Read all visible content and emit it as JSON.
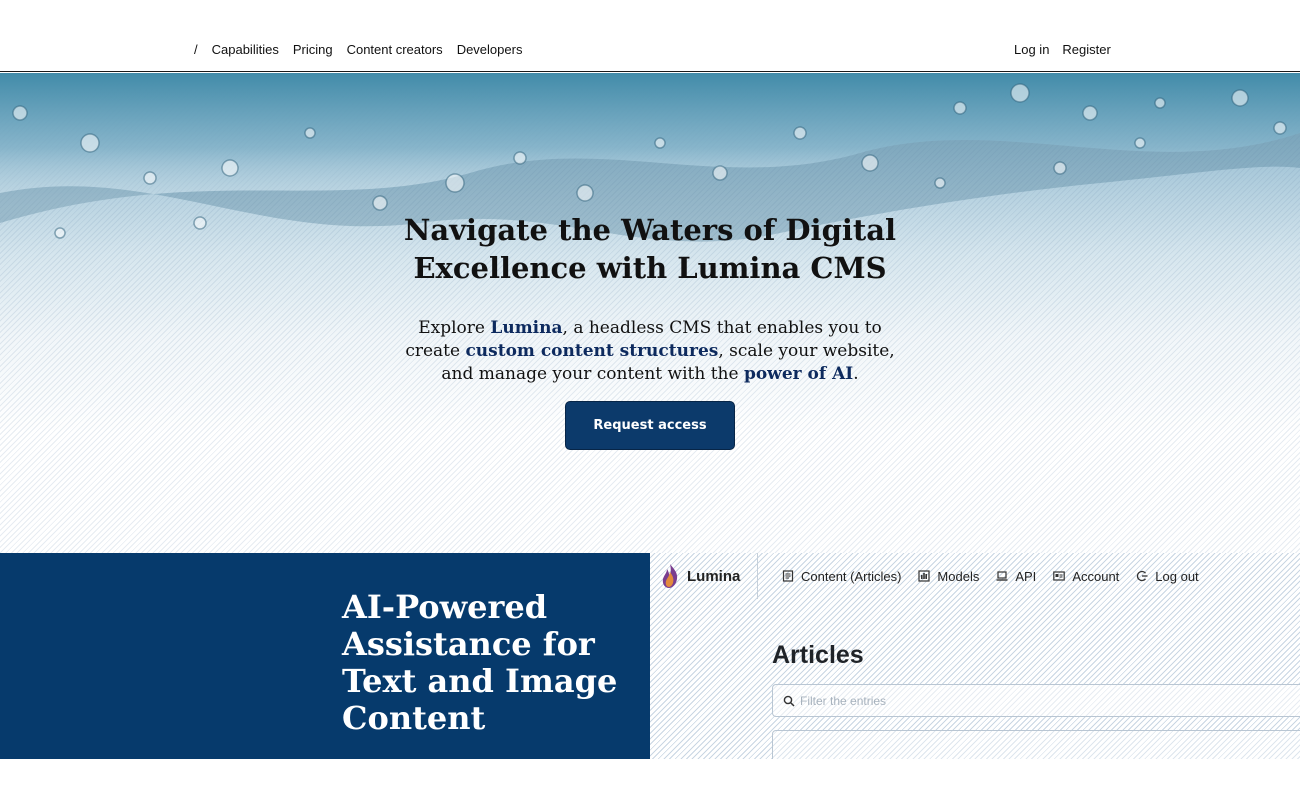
{
  "nav": {
    "separator": "/",
    "links": [
      "Capabilities",
      "Pricing",
      "Content creators",
      "Developers"
    ],
    "login": "Log in",
    "register": "Register"
  },
  "hero": {
    "title_line1": "Navigate the Waters of Digital",
    "title_line2": "Excellence with Lumina CMS",
    "sub": {
      "t1": "Explore ",
      "h1": "Lumina",
      "t2": ", a headless CMS that enables you to create ",
      "h2": "custom content structures",
      "t3": ", scale your website, and manage your content with the ",
      "h3": "power of AI",
      "t4": "."
    },
    "cta": "Request access"
  },
  "feature": {
    "title": "AI-Powered Assistance for Text and Image Content"
  },
  "app_preview": {
    "brand": "Lumina",
    "nav": [
      {
        "label": "Content (Articles)",
        "icon": "document-icon"
      },
      {
        "label": "Models",
        "icon": "models-icon"
      },
      {
        "label": "API",
        "icon": "laptop-icon"
      },
      {
        "label": "Account",
        "icon": "id-card-icon"
      },
      {
        "label": "Log out",
        "icon": "logout-icon"
      }
    ],
    "page_title": "Articles",
    "filter_placeholder": "Filter the entries"
  },
  "colors": {
    "brand_navy": "#063a6c",
    "cta_bg": "#0c3a6b",
    "highlight_text": "#0d2a5e"
  }
}
